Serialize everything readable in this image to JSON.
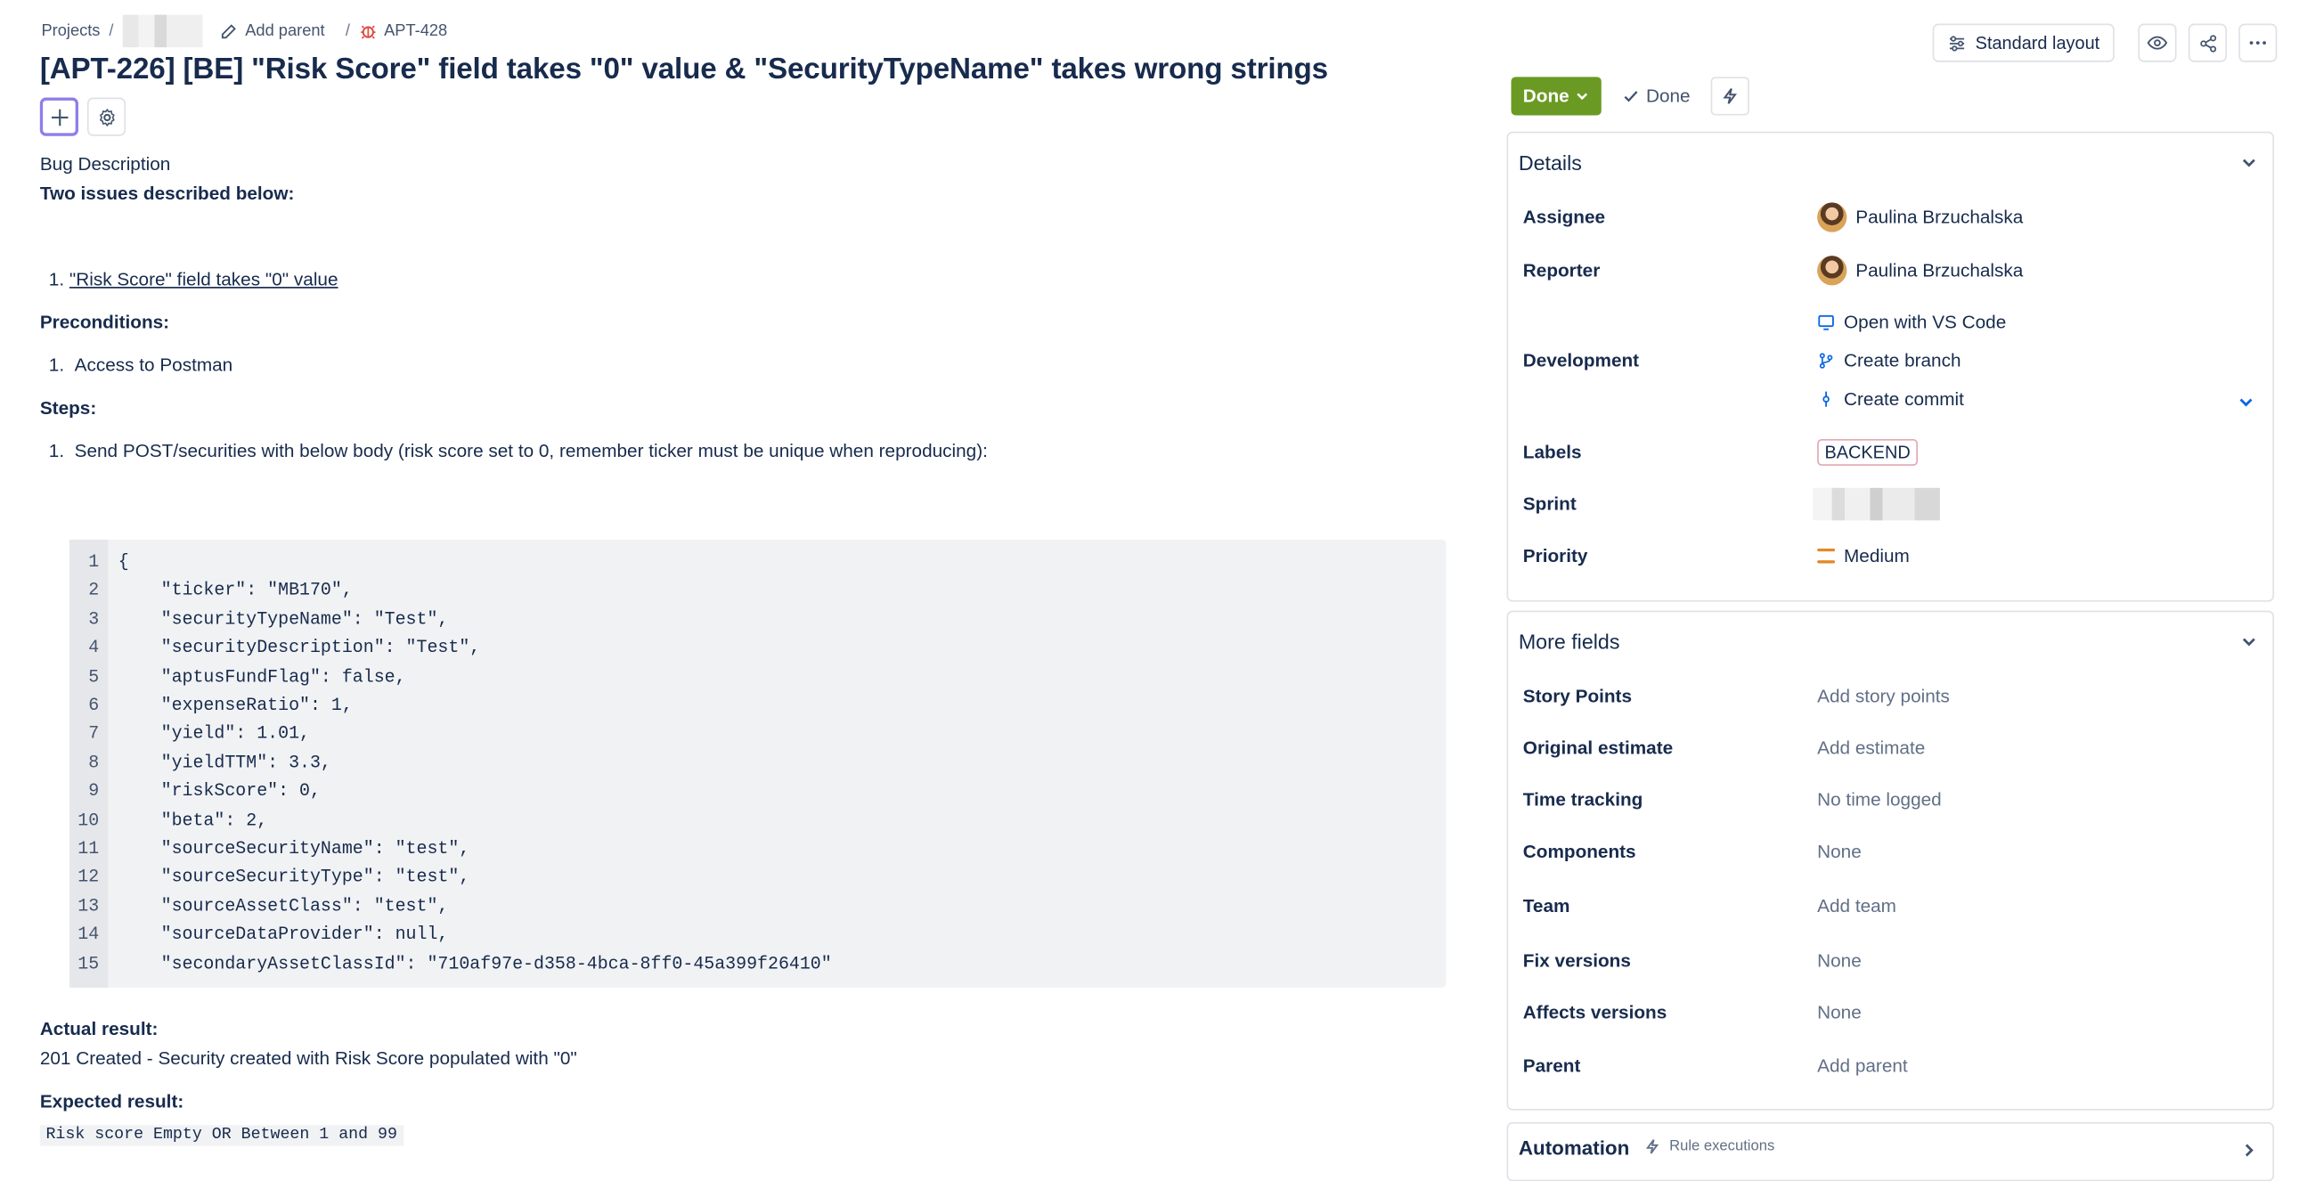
{
  "breadcrumb": {
    "projects": "Projects",
    "add_parent": "Add parent",
    "issue_key": "APT-428"
  },
  "title": "[APT-226] [BE] \"Risk Score\" field takes \"0\" value & \"SecurityTypeName\" takes wrong strings",
  "description": {
    "label": "Bug Description",
    "intro": "Two issues described below:",
    "issue1": "\"Risk Score\" field takes \"0\" value ",
    "preconditions_label": "Preconditions:",
    "precondition1": "Access to Postman",
    "steps_label": "Steps:",
    "step1": "Send POST/securities with below body (risk score set to 0, remember ticker must be unique when reproducing):",
    "code_lines": [
      "{",
      "    \"ticker\": \"MB170\",",
      "    \"securityTypeName\": \"Test\",",
      "    \"securityDescription\": \"Test\",",
      "    \"aptusFundFlag\": false,",
      "    \"expenseRatio\": 1,",
      "    \"yield\": 1.01,",
      "    \"yieldTTM\": 3.3,",
      "    \"riskScore\": 0,",
      "    \"beta\": 2,",
      "    \"sourceSecurityName\": \"test\",",
      "    \"sourceSecurityType\": \"test\",",
      "    \"sourceAssetClass\": \"test\",",
      "    \"sourceDataProvider\": null,",
      "    \"secondaryAssetClassId\": \"710af97e-d358-4bca-8ff0-45a399f26410\""
    ],
    "actual_label": "Actual result:",
    "actual_text": "201 Created - Security created with Risk Score populated with \"0\"",
    "expected_label": "Expected result:",
    "expected_code": "Risk score Empty OR Between 1 and 99"
  },
  "header_actions": {
    "layout_label": "Standard layout"
  },
  "status": {
    "button": "Done",
    "resolution": "Done"
  },
  "details": {
    "title": "Details",
    "assignee_label": "Assignee",
    "assignee": "Paulina Brzuchalska",
    "reporter_label": "Reporter",
    "reporter": "Paulina Brzuchalska",
    "development_label": "Development",
    "open_vscode": "Open with VS Code",
    "create_branch": "Create branch",
    "create_commit": "Create commit",
    "labels_label": "Labels",
    "label_value": "BACKEND",
    "sprint_label": "Sprint",
    "priority_label": "Priority",
    "priority": "Medium"
  },
  "more_fields": {
    "title": "More fields",
    "rows": [
      {
        "k": "Story Points",
        "v": "Add story points"
      },
      {
        "k": "Original estimate",
        "v": "Add estimate"
      },
      {
        "k": "Time tracking",
        "v": "No time logged"
      },
      {
        "k": "Components",
        "v": "None"
      },
      {
        "k": "Team",
        "v": "Add team"
      },
      {
        "k": "Fix versions",
        "v": "None"
      },
      {
        "k": "Affects versions",
        "v": "None"
      },
      {
        "k": "Parent",
        "v": "Add parent"
      }
    ]
  },
  "automation": {
    "title": "Automation",
    "rule_executions": "Rule executions"
  }
}
